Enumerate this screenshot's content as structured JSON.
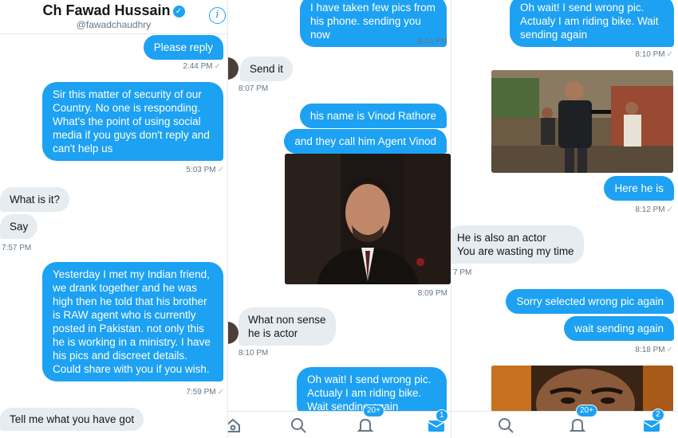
{
  "header": {
    "name": "Ch Fawad Hussain",
    "handle": "@fawadchaudhry"
  },
  "panel1": {
    "m1": "Please reply",
    "t1": "2:44 PM",
    "m2": "Sir this matter of security of our Country. No one is responding. What's the point of using social media if you guys don't reply and can't help us",
    "t2": "5:03 PM",
    "m3": "What is it?",
    "m4": "Say",
    "t4": "7:57 PM",
    "m5": "Yesterday I met my Indian friend, we drank together and he was high then he told that his brother is RAW agent who is currently posted in Pakistan. not only this he is working in a ministry. I have his pics and discreet details. Could share with you if you wish.",
    "t5": "7:59 PM",
    "m6": "Tell me what you have got"
  },
  "panel2": {
    "m1": "I have taken few pics from his phone. sending you now",
    "t1": "8:04 PM",
    "m2": "Send it",
    "t2": "8:07 PM",
    "m3": "his name is Vinod Rathore",
    "m4": "and they call him Agent Vinod",
    "t4": "8:09 PM",
    "m5": "What non sense he is actor",
    "t5": "8:10 PM",
    "m6": "Oh wait! I send wrong pic. Actualy I am riding bike. Wait sending again",
    "badge": "20+",
    "msg_badge": "1"
  },
  "panel3": {
    "m1": "Oh wait! I send wrong pic. Actualy I am riding bike. Wait sending again",
    "t1": "8:10 PM",
    "m2": "Here he is",
    "t2": "8:12 PM",
    "m3": "He is also an actor\nYou are wasting my time",
    "t3": "7 PM",
    "m4": "Sorry selected wrong pic again",
    "m5": "wait sending again",
    "t5": "8:18 PM",
    "badge": "20+",
    "msg_badge": "2"
  },
  "icons": [
    "verified-icon",
    "info-icon",
    "home-icon",
    "search-icon",
    "notifications-icon",
    "messages-icon"
  ],
  "colors": {
    "accent": "#1da1f2",
    "incoming_bubble": "#e6ecf0",
    "text": "#14171a",
    "muted": "#657786"
  }
}
